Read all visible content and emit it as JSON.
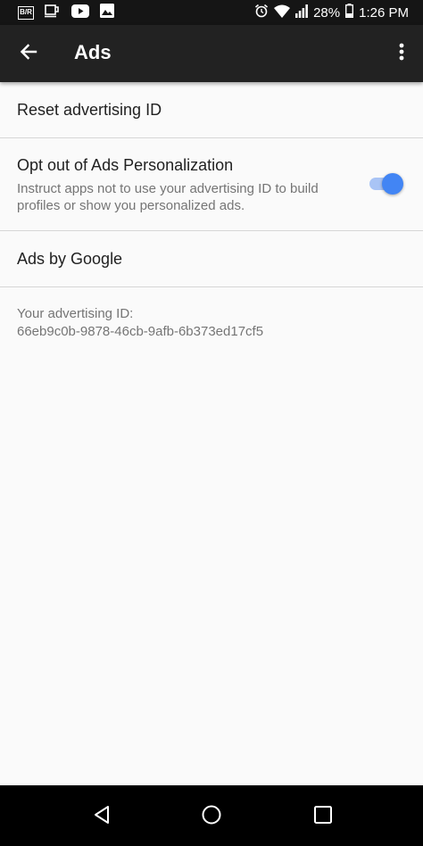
{
  "status_bar": {
    "battery": "28%",
    "time": "1:26 PM",
    "left_icons": [
      "br-app-icon",
      "coffee-cup-icon",
      "youtube-icon",
      "image-icon"
    ],
    "right_icons": [
      "alarm-icon",
      "wifi-icon",
      "signal-icon",
      "battery-icon"
    ]
  },
  "app_bar": {
    "title": "Ads",
    "back_icon": "arrow-back-icon",
    "menu_icon": "more-vert-icon"
  },
  "settings": {
    "reset": {
      "title": "Reset advertising ID"
    },
    "opt_out": {
      "title": "Opt out of Ads Personalization",
      "description": "Instruct apps not to use your advertising ID to build profiles or show you personalized ads.",
      "toggle_on": true
    },
    "ads_by_google": {
      "title": "Ads by Google"
    }
  },
  "advertising_id": {
    "label": "Your advertising ID:",
    "value": "66eb9c0b-9878-46cb-9afb-6b373ed17cf5"
  },
  "nav_bar": {
    "icons": [
      "back-triangle-icon",
      "home-circle-icon",
      "recents-square-icon"
    ]
  },
  "colors": {
    "status_bar": "#151515",
    "app_bar": "#222222",
    "background": "#fafafa",
    "accent": "#4285f4",
    "toggle_track": "#a9c4f5"
  }
}
